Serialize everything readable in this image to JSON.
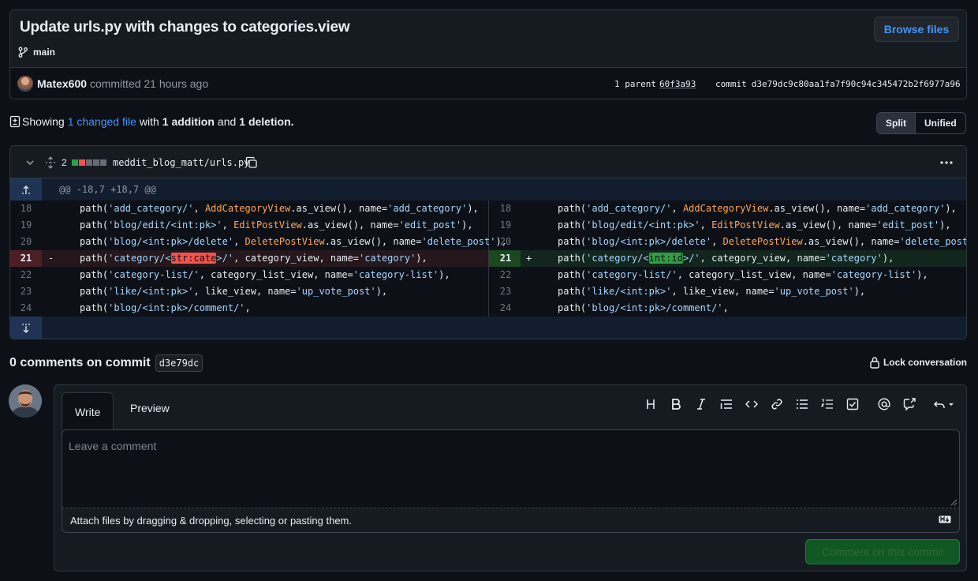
{
  "commit": {
    "title": "Update urls.py with changes to categories.view",
    "branch": "main",
    "browse_label": "Browse files",
    "author": "Matex600",
    "committed_text": "committed 21 hours ago",
    "parent_label": "1 parent",
    "parent_sha": "60f3a93",
    "commit_label": "commit",
    "commit_sha": "d3e79dc9c80aa1fa7f90c94c345472b2f6977a96"
  },
  "summary": {
    "showing": "Showing",
    "changed_files": "1 changed file",
    "with": "with",
    "additions": "1 addition",
    "and": "and",
    "deletions": "1 deletion."
  },
  "view_toggle": {
    "split": "Split",
    "unified": "Unified",
    "selected": "Split"
  },
  "file": {
    "changes_count": "2",
    "diffstat": [
      "added",
      "removed",
      "neutral",
      "neutral",
      "neutral"
    ],
    "path": "meddit_blog_matt/urls.py",
    "hunk_header": "@@ -18,7 +18,7 @@"
  },
  "diff": {
    "left": [
      {
        "ln": "18",
        "sign": "",
        "type": "ctx",
        "pre": "path(",
        "s1": "'add_category/'",
        "mid": ", ",
        "cls": "AddCategoryView",
        "after": ".as_view(), name=",
        "s2": "'add_category'",
        "end": "),"
      },
      {
        "ln": "19",
        "sign": "",
        "type": "ctx",
        "pre": "path(",
        "s1": "'blog/edit/<int:pk>'",
        "mid": ", ",
        "cls": "EditPostView",
        "after": ".as_view(), name=",
        "s2": "'edit_post'",
        "end": "),"
      },
      {
        "ln": "20",
        "sign": "",
        "type": "ctx",
        "pre": "path(",
        "s1": "'blog/<int:pk>/delete'",
        "mid": ", ",
        "cls": "DeletePostView",
        "after": ".as_view(), name=",
        "s2": "'delete_post'",
        "end": "),"
      },
      {
        "ln": "21",
        "sign": "-",
        "type": "del",
        "pre": "path(",
        "s1a": "'category/<",
        "hl": "str:cate",
        "s1b": ">/'",
        "rest": ", category_view, name=",
        "s2": "'category'",
        "end": "),"
      },
      {
        "ln": "22",
        "sign": "",
        "type": "plain",
        "pre": "path(",
        "s1": "'category-list/'",
        "rest": ", category_list_view, name=",
        "s2": "'category-list'",
        "end": "),"
      },
      {
        "ln": "23",
        "sign": "",
        "type": "plain",
        "pre": "path(",
        "s1": "'like/<int:pk>'",
        "rest": ", like_view, name=",
        "s2": "'up_vote_post'",
        "end": "),"
      },
      {
        "ln": "24",
        "sign": "",
        "type": "plain",
        "pre": "path(",
        "s1": "'blog/<int:pk>/comment/'",
        "rest": ",",
        "s2": "",
        "end": ""
      }
    ],
    "right": [
      {
        "ln": "18",
        "sign": "",
        "type": "ctx",
        "pre": "path(",
        "s1": "'add_category/'",
        "mid": ", ",
        "cls": "AddCategoryView",
        "after": ".as_view(), name=",
        "s2": "'add_category'",
        "end": "),"
      },
      {
        "ln": "19",
        "sign": "",
        "type": "ctx",
        "pre": "path(",
        "s1": "'blog/edit/<int:pk>'",
        "mid": ", ",
        "cls": "EditPostView",
        "after": ".as_view(), name=",
        "s2": "'edit_post'",
        "end": "),"
      },
      {
        "ln": "20",
        "sign": "",
        "type": "ctx",
        "pre": "path(",
        "s1": "'blog/<int:pk>/delete'",
        "mid": ", ",
        "cls": "DeletePostView",
        "after": ".as_view(), name=",
        "s2": "'delete_post'",
        "end": "),"
      },
      {
        "ln": "21",
        "sign": "+",
        "type": "add",
        "pre": "path(",
        "s1a": "'category/<",
        "hl": "int:id",
        "s1b": ">/'",
        "rest": ", category_view, name=",
        "s2": "'category'",
        "end": "),"
      },
      {
        "ln": "22",
        "sign": "",
        "type": "plain",
        "pre": "path(",
        "s1": "'category-list/'",
        "rest": ", category_list_view, name=",
        "s2": "'category-list'",
        "end": "),"
      },
      {
        "ln": "23",
        "sign": "",
        "type": "plain",
        "pre": "path(",
        "s1": "'like/<int:pk>'",
        "rest": ", like_view, name=",
        "s2": "'up_vote_post'",
        "end": "),"
      },
      {
        "ln": "24",
        "sign": "",
        "type": "plain",
        "pre": "path(",
        "s1": "'blog/<int:pk>/comment/'",
        "rest": ",",
        "s2": "",
        "end": ""
      }
    ]
  },
  "comments": {
    "title": "0 comments on commit",
    "sha_short": "d3e79dc",
    "lock_label": "Lock conversation",
    "tab_write": "Write",
    "tab_preview": "Preview",
    "placeholder": "Leave a comment",
    "attach_text": "Attach files by dragging & dropping, selecting or pasting them.",
    "submit_label": "Comment on this commit",
    "toolbar_icons": [
      "heading-icon",
      "bold-icon",
      "italic-icon",
      "quote-icon",
      "code-icon",
      "link-icon",
      "unordered-list-icon",
      "ordered-list-icon",
      "task-list-icon",
      "mention-icon",
      "cross-reference-icon",
      "undo-icon"
    ]
  },
  "colors": {
    "background": "#0d1117",
    "link": "#4493f8",
    "deletion": "#f85149",
    "addition": "#2ea043",
    "submit_bg": "#105823"
  }
}
